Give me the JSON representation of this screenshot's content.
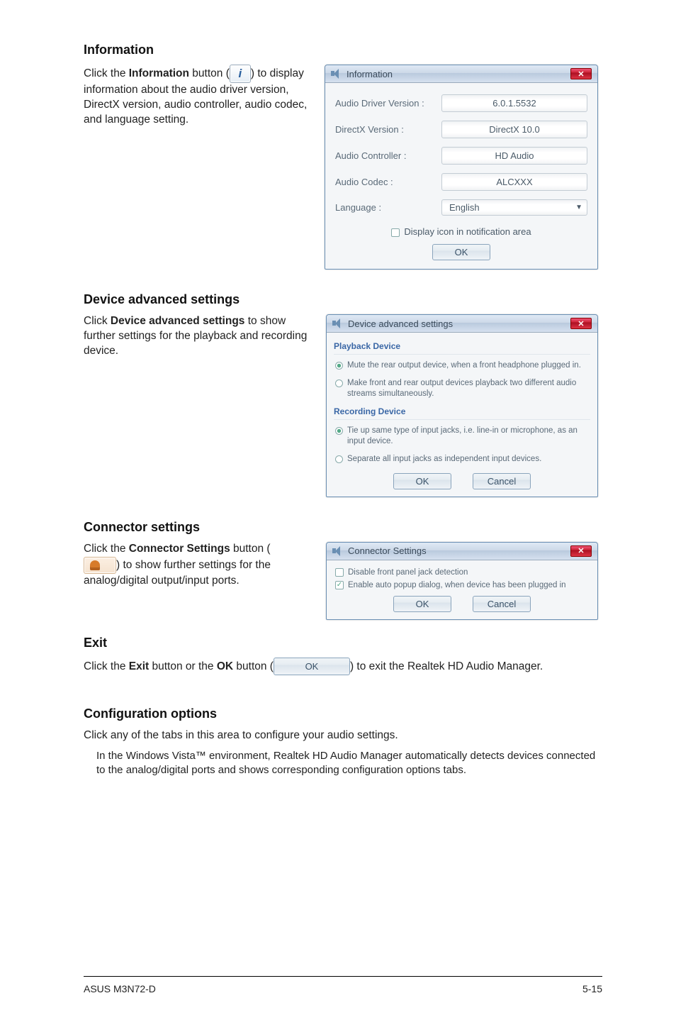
{
  "sections": {
    "information": {
      "heading": "Information",
      "para_prefix": "Click the ",
      "para_bold": "Information",
      "para_mid": " button (",
      "para_suffix": ") to display information about the audio driver version, DirectX version, audio controller, audio codec, and language setting."
    },
    "info_dialog": {
      "title": "Information",
      "rows": {
        "driver_label": "Audio Driver Version :",
        "driver_val": "6.0.1.5532",
        "directx_label": "DirectX Version :",
        "directx_val": "DirectX 10.0",
        "ctrl_label": "Audio Controller :",
        "ctrl_val": "HD Audio",
        "codec_label": "Audio Codec :",
        "codec_val": "ALCXXX",
        "lang_label": "Language :",
        "lang_val": "English"
      },
      "checkbox_label": "Display icon in notification area",
      "ok": "OK"
    },
    "device": {
      "heading": "Device advanced settings",
      "para_prefix": "Click ",
      "para_bold": "Device advanced settings",
      "para_suffix": " to show further settings for the playback and recording device."
    },
    "device_dialog": {
      "title": "Device advanced settings",
      "playback_head": "Playback Device",
      "playback_opt1": "Mute the rear output device, when a front headphone plugged in.",
      "playback_opt2": "Make front and rear output devices playback two different audio streams simultaneously.",
      "recording_head": "Recording Device",
      "recording_opt1": "Tie up same type of input jacks, i.e. line-in or microphone, as an input device.",
      "recording_opt2": "Separate all input jacks as independent input devices.",
      "ok": "OK",
      "cancel": "Cancel"
    },
    "connector": {
      "heading": "Connector settings",
      "para_prefix": "Click the ",
      "para_bold": "Connector Settings",
      "para_mid": " button (",
      "para_suffix": ") to show further settings for the analog/digital output/input ports."
    },
    "connector_dialog": {
      "title": "Connector Settings",
      "opt1": "Disable front panel jack detection",
      "opt2": "Enable auto popup dialog, when device has been plugged in",
      "ok": "OK",
      "cancel": "Cancel"
    },
    "exit": {
      "heading": "Exit",
      "p1a": "Click the ",
      "p1b": "Exit",
      "p1c": " button or the ",
      "p1d": "OK",
      "p1e": " button (",
      "p1f": ") to exit the Realtek HD Audio Manager.",
      "ok_inline": "OK"
    },
    "config": {
      "heading": "Configuration options",
      "para": "Click any of the tabs in this area to configure your audio settings.",
      "note": "In the Windows Vista™ environment, Realtek HD Audio Manager automatically detects devices connected to the analog/digital ports and shows corresponding configuration options tabs."
    }
  },
  "footer": {
    "left": "ASUS M3N72-D",
    "right": "5-15"
  }
}
